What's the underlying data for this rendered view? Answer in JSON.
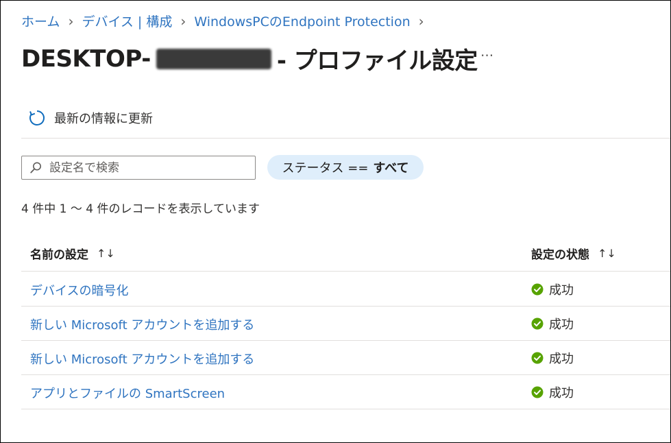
{
  "breadcrumb": {
    "items": [
      "ホーム",
      "デバイス | 構成",
      "WindowsPCのEndpoint Protection"
    ]
  },
  "page": {
    "title_prefix": "DESKTOP-",
    "title_suffix": "- プロファイル設定",
    "more_label": "···"
  },
  "toolbar": {
    "refresh_label": "最新の情報に更新"
  },
  "search": {
    "placeholder": "設定名で検索",
    "value": ""
  },
  "filter": {
    "label": "ステータス ==",
    "value": "すべて"
  },
  "record_count": "4 件中 1 ～ 4 件のレコードを表示しています",
  "table": {
    "columns": [
      {
        "label": "名前の設定",
        "sort": "↑↓"
      },
      {
        "label": "設定の状態",
        "sort": "↑↓"
      }
    ],
    "rows": [
      {
        "name": "デバイスの暗号化",
        "status": "成功"
      },
      {
        "name": "新しい Microsoft アカウントを追加する",
        "status": "成功"
      },
      {
        "name": "新しい Microsoft アカウントを追加する",
        "status": "成功"
      },
      {
        "name": "アプリとファイルの SmartScreen",
        "status": "成功"
      }
    ]
  },
  "icons": {
    "refresh": "refresh-icon",
    "search": "search-icon",
    "status": "success-check-icon"
  },
  "colors": {
    "link": "#2f74c0",
    "success": "#57a300",
    "filter_pill": "#dfeefb"
  }
}
